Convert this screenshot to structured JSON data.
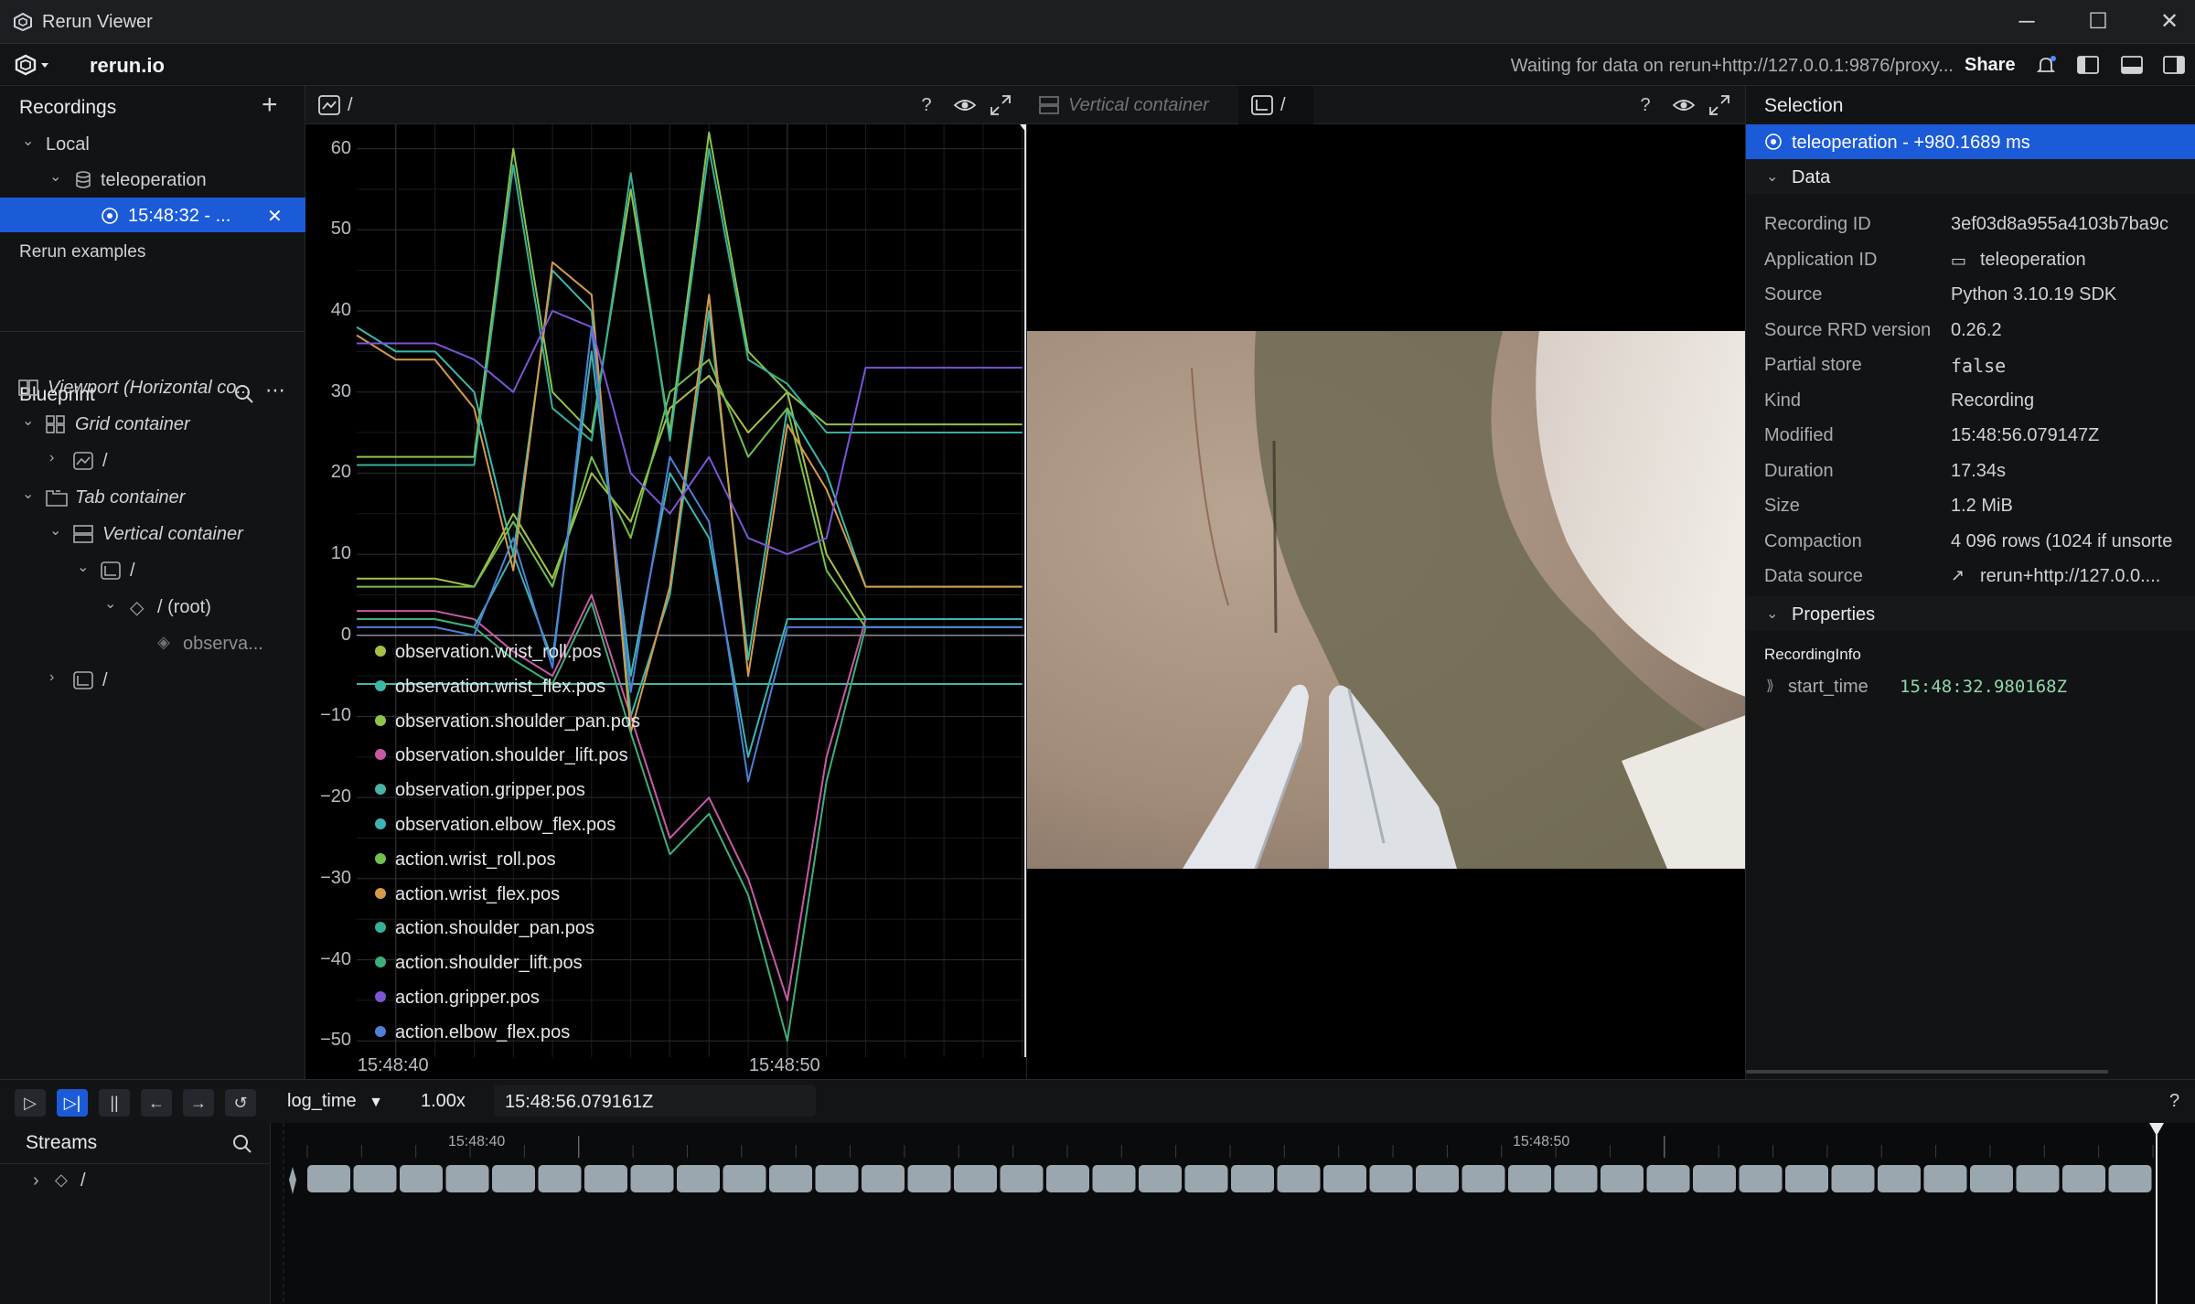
{
  "window": {
    "title": "Rerun Viewer",
    "minimize": "─",
    "maximize": "☐",
    "close": "✕"
  },
  "topbar": {
    "brand": "rerun.io",
    "status": "Waiting for data on rerun+http://127.0.0.1:9876/proxy...",
    "share": "Share"
  },
  "recordings": {
    "title": "Recordings",
    "local": "Local",
    "app": "teleoperation",
    "recording": "15:48:32 - ...",
    "examples": "Rerun examples"
  },
  "blueprint": {
    "title": "Blueprint",
    "items": [
      {
        "label": "Viewport (Horizontal co..."
      },
      {
        "label": "Grid container"
      },
      {
        "label": "/"
      },
      {
        "label": "Tab container"
      },
      {
        "label": "Vertical container"
      },
      {
        "label": "/"
      },
      {
        "label": "/ (root)"
      },
      {
        "label": "observa..."
      },
      {
        "label": "/"
      }
    ]
  },
  "views": {
    "plot_tab": "/",
    "container_tab": "Vertical container",
    "image_tab": "/",
    "help": "?"
  },
  "chart_data": {
    "type": "line",
    "title": "",
    "xlabel": "",
    "ylabel": "",
    "ylim": [
      -52,
      63
    ],
    "y_ticks": [
      60,
      50,
      40,
      30,
      20,
      10,
      0,
      -10,
      -20,
      -30,
      -40,
      -50
    ],
    "y_tick_labels": [
      "60",
      "50",
      "40",
      "30",
      "20",
      "10",
      "0",
      "−10",
      "−20",
      "−30",
      "−40",
      "−50"
    ],
    "x_ticks": [
      "15:48:40",
      "15:48:50"
    ],
    "x_tick_seconds": [
      40,
      50
    ],
    "xlim": [
      39,
      56.1
    ],
    "cursor_seconds": 56.08,
    "grid": true,
    "legend_position": "bottom-left",
    "series": [
      {
        "name": "observation.wrist_roll.pos",
        "color": "#a6c04a",
        "x": [
          39,
          40,
          41,
          42,
          43,
          44,
          45,
          46,
          47,
          48,
          49,
          50,
          51,
          52,
          56
        ],
        "y": [
          7,
          7,
          7,
          6,
          15,
          7,
          20,
          14,
          28,
          32,
          25,
          30,
          10,
          2,
          2
        ]
      },
      {
        "name": "observation.wrist_flex.pos",
        "color": "#3bb8a8",
        "x": [
          39,
          40,
          41,
          42,
          43,
          44,
          45,
          46,
          47,
          48,
          49,
          50,
          51,
          52,
          56
        ],
        "y": [
          38,
          35,
          35,
          30,
          10,
          45,
          40,
          -10,
          5,
          40,
          -3,
          28,
          20,
          6,
          6
        ]
      },
      {
        "name": "observation.shoulder_pan.pos",
        "color": "#8dc34a",
        "x": [
          39,
          40,
          41,
          42,
          43,
          44,
          45,
          46,
          47,
          48,
          49,
          50,
          51,
          52,
          56
        ],
        "y": [
          22,
          22,
          22,
          22,
          60,
          30,
          25,
          55,
          25,
          62,
          35,
          30,
          26,
          26,
          26
        ]
      },
      {
        "name": "observation.shoulder_lift.pos",
        "color": "#c75aa5",
        "x": [
          39,
          40,
          41,
          42,
          43,
          44,
          45,
          46,
          47,
          48,
          49,
          50,
          51,
          52,
          56
        ],
        "y": [
          3,
          3,
          3,
          2,
          -2,
          -5,
          5,
          -10,
          -25,
          -20,
          -30,
          -45,
          -15,
          2,
          2
        ]
      },
      {
        "name": "observation.gripper.pos",
        "color": "#49b3a5",
        "x": [
          39,
          40,
          41,
          42,
          43,
          44,
          45,
          46,
          47,
          48,
          49,
          50,
          51,
          52,
          56
        ],
        "y": [
          -6,
          -6,
          -6,
          -6,
          -6,
          -6,
          -6,
          -6,
          -6,
          -6,
          -6,
          -6,
          -6,
          -6,
          -6
        ]
      },
      {
        "name": "observation.elbow_flex.pos",
        "color": "#3cb4b4",
        "x": [
          39,
          40,
          41,
          42,
          43,
          44,
          45,
          46,
          47,
          48,
          49,
          50,
          51,
          52,
          56
        ],
        "y": [
          2,
          2,
          2,
          1,
          10,
          -3,
          35,
          -5,
          20,
          12,
          -15,
          2,
          2,
          2,
          2
        ]
      },
      {
        "name": "action.wrist_roll.pos",
        "color": "#6fc04e",
        "x": [
          39,
          40,
          41,
          42,
          43,
          44,
          45,
          46,
          47,
          48,
          49,
          50,
          51,
          52,
          56
        ],
        "y": [
          6,
          6,
          6,
          6,
          14,
          6,
          22,
          12,
          30,
          34,
          22,
          28,
          8,
          1,
          1
        ]
      },
      {
        "name": "action.wrist_flex.pos",
        "color": "#d49a4a",
        "x": [
          39,
          40,
          41,
          42,
          43,
          44,
          45,
          46,
          47,
          48,
          49,
          50,
          51,
          52,
          56
        ],
        "y": [
          37,
          34,
          34,
          28,
          8,
          46,
          42,
          -12,
          6,
          42,
          -5,
          26,
          18,
          6,
          6
        ]
      },
      {
        "name": "action.shoulder_pan.pos",
        "color": "#36b09a",
        "x": [
          39,
          40,
          41,
          42,
          43,
          44,
          45,
          46,
          47,
          48,
          49,
          50,
          51,
          52,
          56
        ],
        "y": [
          21,
          21,
          21,
          21,
          58,
          28,
          24,
          57,
          24,
          60,
          34,
          31,
          25,
          25,
          25
        ]
      },
      {
        "name": "action.shoulder_lift.pos",
        "color": "#3fae7a",
        "x": [
          39,
          40,
          41,
          42,
          43,
          44,
          45,
          46,
          47,
          48,
          49,
          50,
          51,
          52,
          56
        ],
        "y": [
          2,
          2,
          2,
          1,
          -3,
          -6,
          4,
          -12,
          -27,
          -22,
          -32,
          -50,
          -18,
          1,
          1
        ]
      },
      {
        "name": "action.gripper.pos",
        "color": "#7b55d6",
        "x": [
          39,
          40,
          41,
          42,
          43,
          44,
          45,
          46,
          47,
          48,
          49,
          50,
          51,
          52,
          56
        ],
        "y": [
          36,
          36,
          36,
          34,
          30,
          40,
          38,
          20,
          15,
          22,
          12,
          10,
          12,
          33,
          33
        ]
      },
      {
        "name": "action.elbow_flex.pos",
        "color": "#4f7fd6",
        "x": [
          39,
          40,
          41,
          42,
          43,
          44,
          45,
          46,
          47,
          48,
          49,
          50,
          51,
          52,
          56
        ],
        "y": [
          1,
          1,
          1,
          0,
          12,
          -4,
          38,
          -7,
          22,
          14,
          -18,
          1,
          1,
          1,
          1
        ]
      }
    ]
  },
  "selection": {
    "title": "Selection",
    "item": "teleoperation - +980.1689 ms",
    "data_title": "Data",
    "rows": [
      {
        "k": "Recording ID",
        "v": "3ef03d8a955a4103b7ba9c"
      },
      {
        "k": "Application ID",
        "v": "teleoperation"
      },
      {
        "k": "Source",
        "v": "Python 3.10.19 SDK"
      },
      {
        "k": "Source RRD version",
        "v": "0.26.2"
      },
      {
        "k": "Partial store",
        "v": "false"
      },
      {
        "k": "Kind",
        "v": "Recording"
      },
      {
        "k": "Modified",
        "v": "15:48:56.079147Z"
      },
      {
        "k": "Duration",
        "v": "17.34s"
      },
      {
        "k": "Size",
        "v": "1.2 MiB"
      },
      {
        "k": "Compaction",
        "v": "4 096 rows (1024 if unsorte"
      },
      {
        "k": "Data source",
        "v": "rerun+http://127.0.0...."
      }
    ],
    "properties_title": "Properties",
    "recording_info": "RecordingInfo",
    "start_time_key": "start_time",
    "start_time_value": "15:48:32.980168Z"
  },
  "timecontrols": {
    "timeline": "log_time",
    "speed": "1.00x",
    "current": "15:48:56.079161Z",
    "help": "?"
  },
  "streams": {
    "title": "Streams",
    "root": "/"
  },
  "timeline": {
    "tick1": "15:48:40",
    "tick2": "15:48:50"
  }
}
